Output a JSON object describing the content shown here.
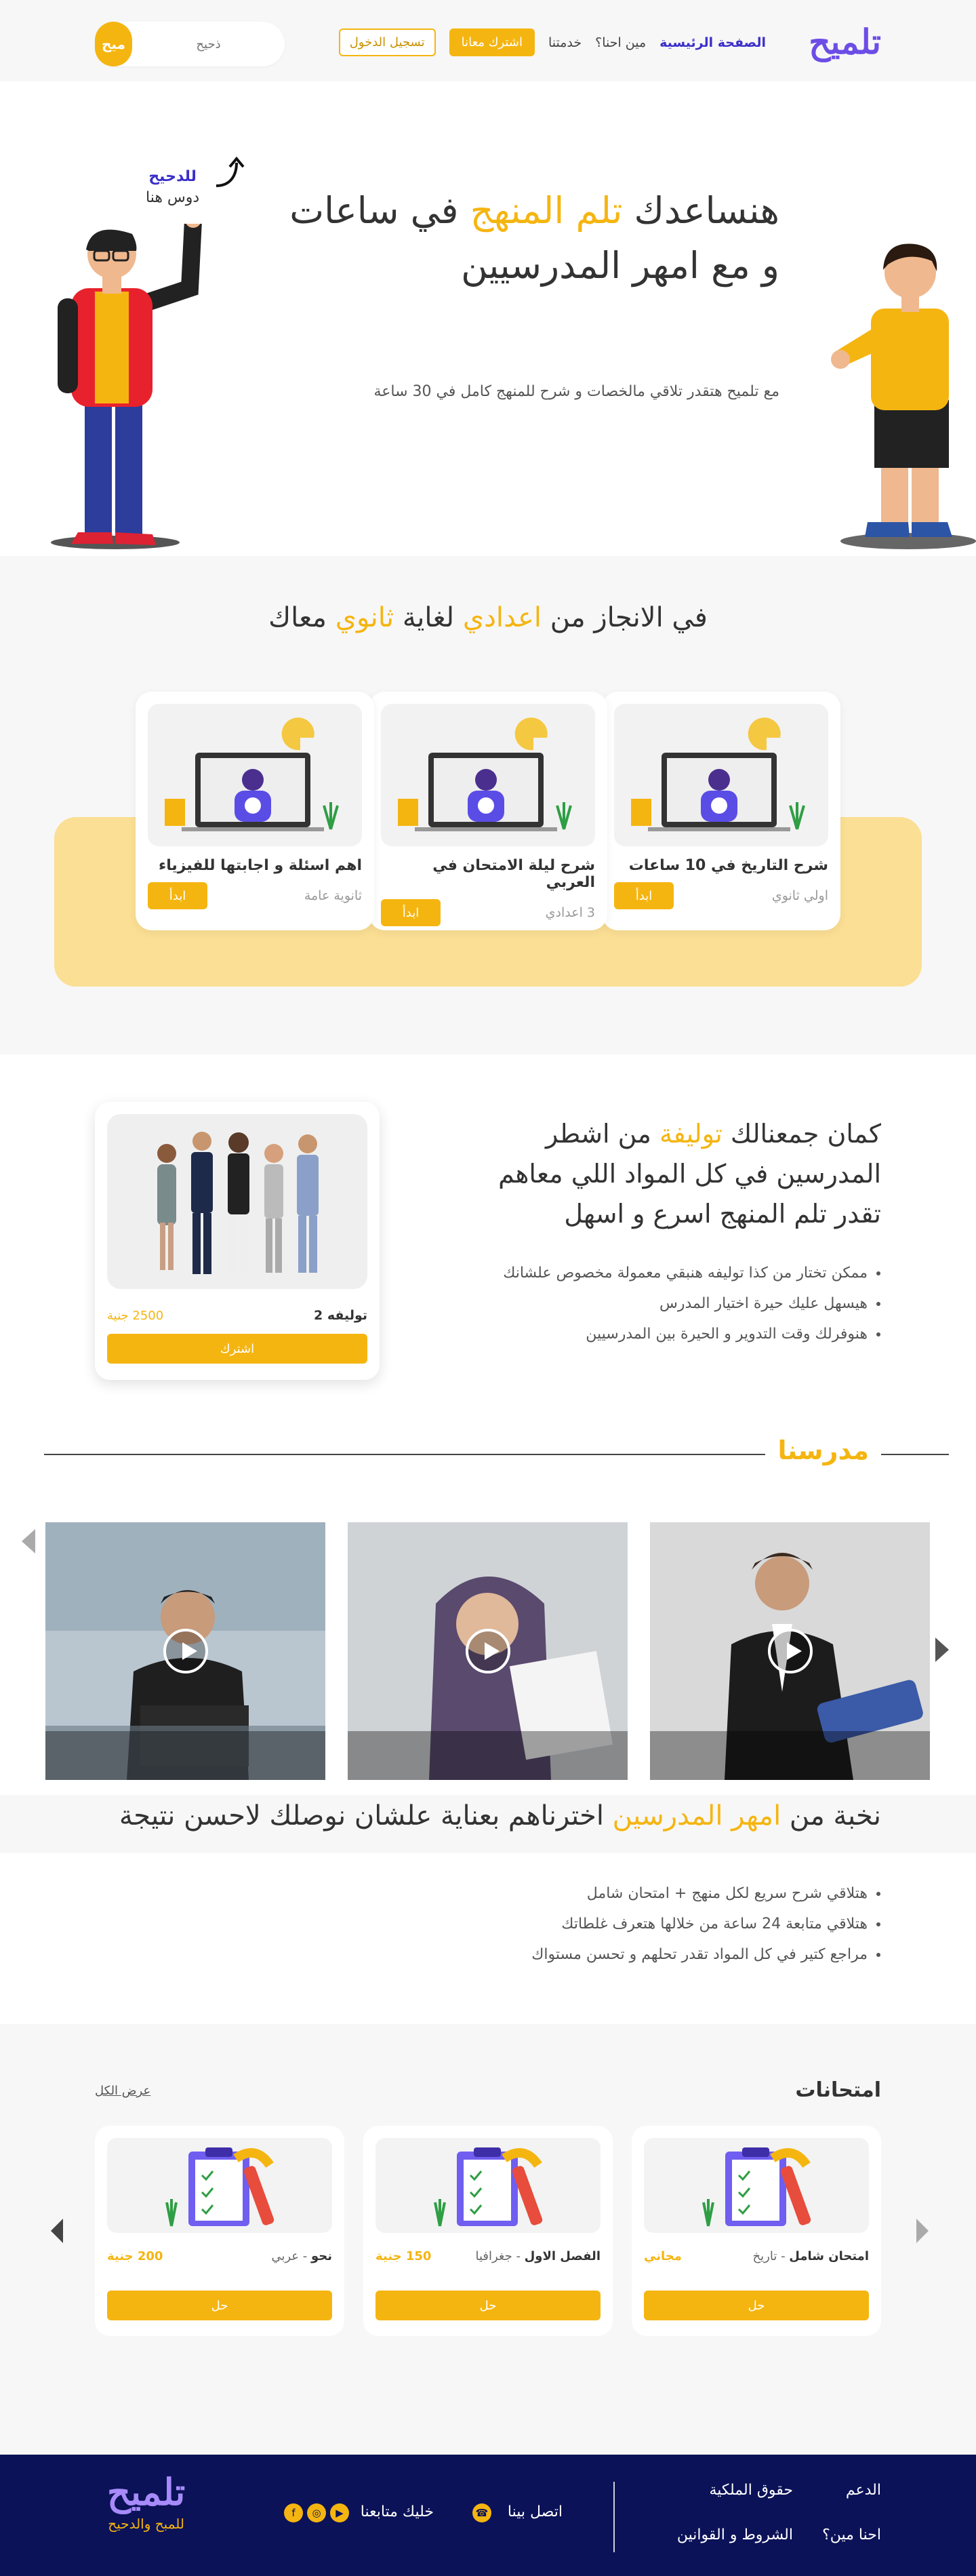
{
  "header": {
    "logo": "تلميح",
    "nav": [
      {
        "label": "الصفحة الرئيسية",
        "active": true
      },
      {
        "label": "مين احنا؟",
        "active": false
      },
      {
        "label": "خدمتنا",
        "active": false
      }
    ],
    "subscribe_label": "اشترك معانا",
    "login_label": "تسجيل الدخول",
    "search_placeholder": "ذحيح",
    "search_button": "ميح"
  },
  "hero": {
    "title_pre": "هنساعدك ",
    "title_accent": "تلم المنهج",
    "title_post": " في ساعات",
    "title_line2": "و مع امهر المدرسيين",
    "subtitle": "مع تلميح هتقدر تلاقي مالخصات و شرح للمنهج كامل في 30 ساعة",
    "hint_line1": "للدحيح",
    "hint_line2": "دوس هنا"
  },
  "stages": {
    "title_pre": "في الانجاز من ",
    "title_accent1": "اعدادي",
    "title_mid": " لغاية ",
    "title_accent2": "ثانوي",
    "title_post": " معاك",
    "cards": [
      {
        "title": "شرح التاريخ في 10 ساعات",
        "level": "اولي ثانوي",
        "button": "ابدأ"
      },
      {
        "title": "شرح ليلة الامتحان في العربي",
        "level": "3 اعدادي",
        "button": "ابدأ"
      },
      {
        "title": "اهم اسئلة و اجابتها للفيزياء",
        "level": "ثانوية عامة",
        "button": "ابدأ"
      }
    ]
  },
  "bundle": {
    "title_pre": "كمان جمعنالك ",
    "title_accent": "توليفة",
    "title_post": " من اشطر المدرسين في كل المواد اللي معاهم تقدر تلم المنهج اسرع و اسهل",
    "bullets": [
      "ممكن تختار من كذا توليفه هنبقي معمولة مخصوص علشانك",
      "هيسهل عليك  حيرة اختيار المدرس",
      "هنوفرلك وقت التدوير و الحيرة بين المدرسيين"
    ],
    "card": {
      "name": "توليفه 2",
      "price": "2500 جنية",
      "button": "اشترك"
    }
  },
  "teachers": {
    "title": "مدرسنا"
  },
  "elite": {
    "title_pre": "نخبة من ",
    "title_accent": "امهر المدرسين",
    "title_post": " اخترناهم بعناية علشان نوصلك لاحسن نتيجة",
    "bullets": [
      "هتلاقي شرح سريع لكل منهج + امتحان شامل",
      "هتلاقي متابعة 24 ساعة من خلالها هتعرف غلطاتك",
      "مراجع كتير في كل المواد تقدر تحلهم و تحسن مستواك"
    ]
  },
  "exams": {
    "title": "امتحانات",
    "view_all": "عرض الكل",
    "cards": [
      {
        "name": "امتحان شامل",
        "subject": " - تاريخ",
        "price": "مجاني",
        "button": "حل"
      },
      {
        "name": "الفصل الاول",
        "subject": " - جغرافيا",
        "price": "150 جنية",
        "button": "حل"
      },
      {
        "name": "نحو",
        "subject": " - عربي",
        "price": "200 جنية",
        "button": "حل"
      }
    ]
  },
  "footer": {
    "links": [
      "الدعم",
      "حقوق الملكية",
      "احنا مين؟",
      "الشروط و القوانين"
    ],
    "contact": "اتصل بينا",
    "follow": "خليك متابعنا",
    "logo": "تلميح",
    "tagline": "للمبح والدحيح"
  },
  "colors": {
    "accent": "#f5b511",
    "brand": "#6c4de6",
    "footer": "#0b1258"
  }
}
